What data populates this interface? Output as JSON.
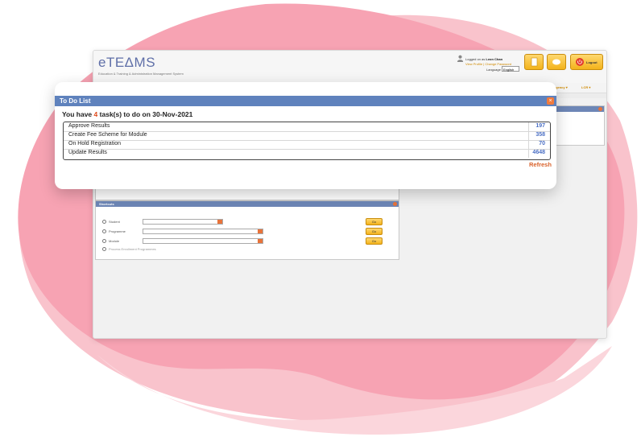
{
  "app": {
    "logo": "eTEΔMS",
    "tagline": "Education & Training & Administration Management System",
    "logged_in_prefix": "Logged on as",
    "user_name": "Leon Chan",
    "view_profile": "View Profile",
    "change_password": "Change Password",
    "language_label": "Language",
    "language_value": "English",
    "logout_label": "Logout",
    "menu_items": [
      "...gh Agency ▾",
      "LCR ▾"
    ]
  },
  "shortcuts": {
    "title": "Shortcuts",
    "rows": [
      "Student",
      "Programme",
      "Module",
      "Process Enrollment Programmes"
    ],
    "go_label": "Go"
  },
  "todo": {
    "title": "To Do List",
    "summary_prefix": "You have",
    "task_count": "4",
    "summary_suffix": "task(s) to do on 30-Nov-2021",
    "tasks": [
      {
        "name": "Approve Results",
        "count": "197"
      },
      {
        "name": "Create Fee Scheme for Module",
        "count": "358"
      },
      {
        "name": "On Hold Registration",
        "count": "70"
      },
      {
        "name": "Update Results",
        "count": "4648"
      }
    ],
    "refresh_label": "Refresh",
    "close_glyph": "×"
  },
  "colors": {
    "blob_pink": "#f7a8b6",
    "blob_light": "#fbd6dc",
    "title_bar": "#5f82bd",
    "accent_orange": "#e04a1a",
    "count_blue": "#4b6fc4"
  }
}
